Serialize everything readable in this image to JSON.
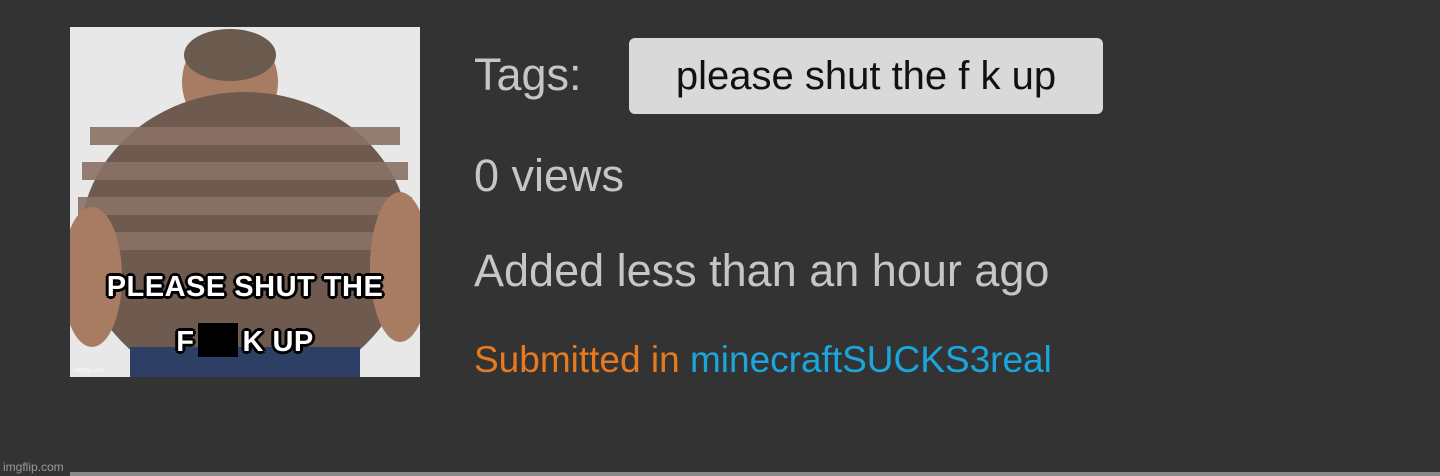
{
  "meme": {
    "caption_top": "PLEASE SHUT THE",
    "caption_bottom_start": "F",
    "caption_bottom_end": "K UP",
    "watermark": "imgflip.com"
  },
  "tags": {
    "label": "Tags:",
    "items": [
      "please shut the f k up"
    ]
  },
  "views": "0 views",
  "added": "Added less than an hour ago",
  "submission": {
    "prefix": "Submitted in",
    "stream": "minecraftSUCKS3real",
    "prefix_color": "#e57a1f",
    "stream_color": "#1aa6dc"
  },
  "footer": {
    "watermark": "imgflip.com"
  }
}
